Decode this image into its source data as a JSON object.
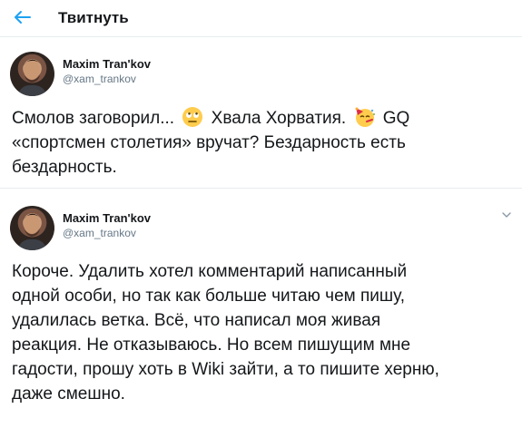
{
  "header": {
    "title": "Твитнуть",
    "back_icon": "arrow-left-icon"
  },
  "colors": {
    "accent": "#1da1f2",
    "text": "#14171a",
    "secondary": "#657786",
    "divider": "#e6ecf0"
  },
  "tweets": [
    {
      "author": {
        "name": "Maxim Tran'kov",
        "handle": "@xam_trankov"
      },
      "lines": [
        {
          "seg1": "Смолов заговорил...",
          "emoji1": "rolling-eyes-emoji",
          "seg2": "Хвала Хорватия.",
          "emoji2": "partying-face-emoji",
          "seg3": "GQ"
        },
        {
          "text": "«спортсмен столетия» вручат? Бездарность есть"
        },
        {
          "text": "бездарность."
        }
      ]
    },
    {
      "author": {
        "name": "Maxim Tran'kov",
        "handle": "@xam_trankov"
      },
      "menu_icon": "chevron-down-icon",
      "lines": [
        "Короче. Удалить хотел комментарий написанный",
        "одной особи, но так как больше читаю чем пишу,",
        "удалилась ветка. Всё, что написал моя живая",
        "реакция. Не отказываюсь. Но всем пишущим мне",
        "гадости, прошу хоть в Wiki зайти, а то пишите херню,",
        "даже смешно."
      ]
    }
  ]
}
